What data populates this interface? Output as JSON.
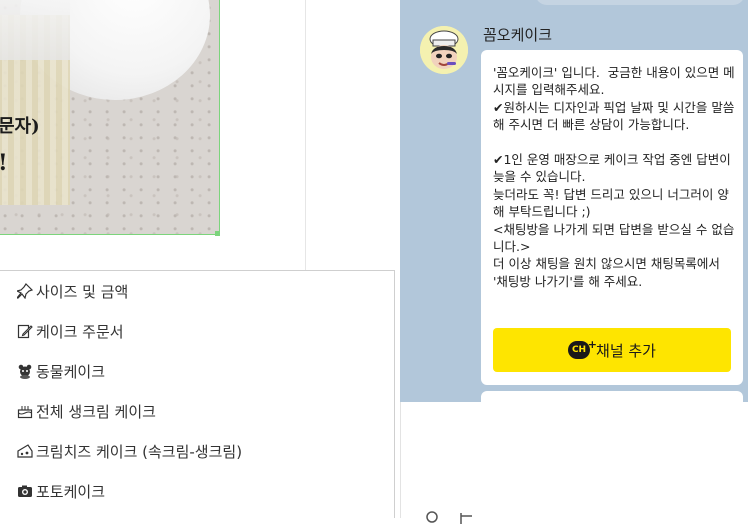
{
  "menu": {
    "items": [
      {
        "label": "사이즈 및 금액",
        "icon": "pin-icon"
      },
      {
        "label": "케이크 주문서",
        "icon": "edit-icon"
      },
      {
        "label": "동물케이크",
        "icon": "bear-icon"
      },
      {
        "label": "전체 생크림 케이크",
        "icon": "cake-icon"
      },
      {
        "label": "크림치즈 케이크 (속크림-생크림)",
        "icon": "cheese-icon"
      },
      {
        "label": "포토케이크",
        "icon": "camera-icon"
      }
    ]
  },
  "photo": {
    "text_line1": "문자)",
    "text_line2": "!"
  },
  "chat": {
    "sender_name": "꼼오케이크",
    "message": "'꼼오케이크' 입니다.  궁금한 내용이 있으면 메시지를 입력해주세요.\n✔원하시는 디자인과 픽업 날짜 및 시간을 말씀해 주시면 더 빠른 상담이 가능합니다.\n\n✔1인 운영 매장으로 케이크 작업 중엔 답변이 늦을 수 있습니다.\n늦더라도 꼭! 답변 드리고 있으니 너그러이 양해 부탁드립니다 ;)\n<채팅방을 나가게 되면 답변을 받으실 수 없습니다.>\n더 이상 채팅을 원치 않으시면 채팅목록에서 '채팅방 나가기'를 해 주세요.",
    "add_channel_label": "채널 추가",
    "channel_icon_text": "CH",
    "colors": {
      "chat_bg": "#b2c7da",
      "button": "#fee500"
    }
  }
}
